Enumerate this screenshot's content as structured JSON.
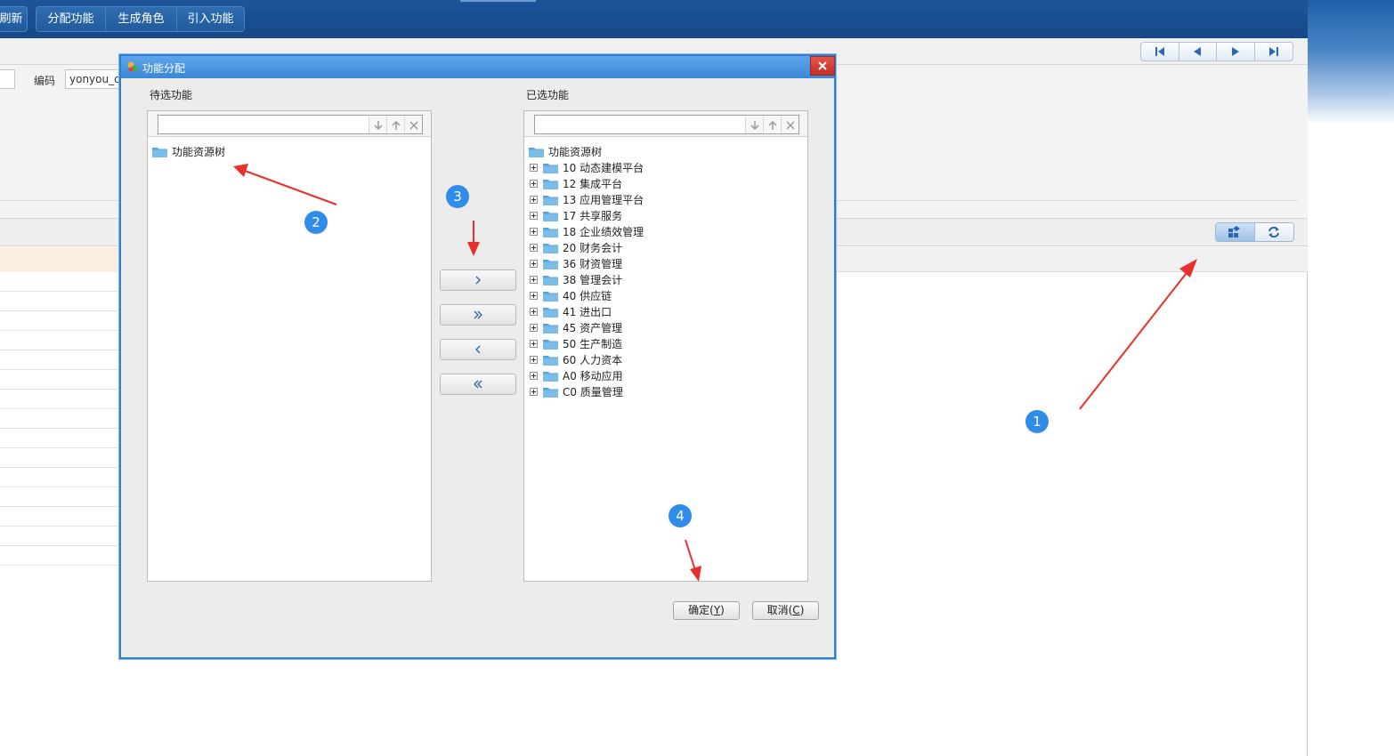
{
  "app": {
    "toolbar": {
      "refresh_label": "刷新",
      "assign_label": "分配功能",
      "generate_role_label": "生成角色",
      "import_label": "引入功能"
    },
    "form": {
      "code_label": "编码",
      "code_value": "yonyou_qc"
    },
    "nav_icons": [
      "first-page-icon",
      "prev-page-icon",
      "next-page-icon",
      "last-page-icon"
    ],
    "view_icons": [
      "card-view-icon",
      "refresh-view-icon"
    ]
  },
  "dialog": {
    "title": "功能分配",
    "left_pane": {
      "label": "待选功能",
      "search_value": "",
      "tree": [
        {
          "label": "功能资源树",
          "root": true
        }
      ]
    },
    "right_pane": {
      "label": "已选功能",
      "search_value": "",
      "tree": [
        {
          "label": "功能资源树",
          "root": true
        },
        {
          "label": "10 动态建模平台"
        },
        {
          "label": "12 集成平台"
        },
        {
          "label": "13 应用管理平台"
        },
        {
          "label": "17 共享服务"
        },
        {
          "label": "18 企业绩效管理"
        },
        {
          "label": "20 财务会计"
        },
        {
          "label": "36 财资管理"
        },
        {
          "label": "38 管理会计"
        },
        {
          "label": "40 供应链"
        },
        {
          "label": "41 进出口"
        },
        {
          "label": "45 资产管理"
        },
        {
          "label": "50 生产制造"
        },
        {
          "label": "60 人力资本"
        },
        {
          "label": "A0 移动应用"
        },
        {
          "label": "C0 质量管理"
        }
      ]
    },
    "move_buttons": [
      "move-right-icon",
      "move-all-right-icon",
      "move-left-icon",
      "move-all-left-icon"
    ],
    "ok_label": "确定(",
    "ok_key": "Y",
    "ok_tail": ")",
    "cancel_label": "取消(",
    "cancel_key": "C",
    "cancel_tail": ")"
  },
  "annotations": {
    "badges": [
      "1",
      "2",
      "3",
      "4"
    ],
    "colors": {
      "badge": "#2f8ce8",
      "arrow": "#e8302a",
      "dialog_border": "#2d7fd2"
    }
  }
}
